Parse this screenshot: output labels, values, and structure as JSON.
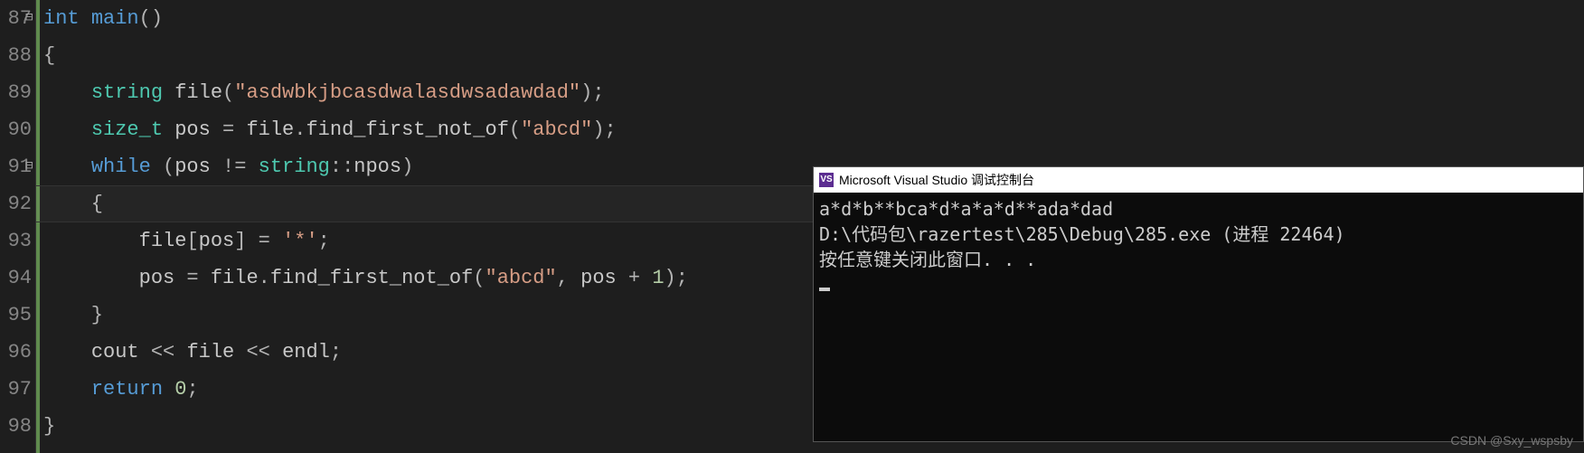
{
  "line_numbers": [
    "87",
    "88",
    "89",
    "90",
    "91",
    "92",
    "93",
    "94",
    "95",
    "96",
    "97",
    "98"
  ],
  "code_tokens": [
    [
      [
        "kw",
        "int"
      ],
      [
        "op",
        " "
      ],
      [
        "kw",
        "main"
      ],
      [
        "op",
        "()"
      ]
    ],
    [
      [
        "op",
        "{"
      ]
    ],
    [
      [
        "op",
        "    "
      ],
      [
        "type",
        "string"
      ],
      [
        "op",
        " "
      ],
      [
        "id",
        "file"
      ],
      [
        "op",
        "("
      ],
      [
        "str",
        "\"asdwbkjbcasdwalasdwsadawdad\""
      ],
      [
        "op",
        ");"
      ]
    ],
    [
      [
        "op",
        "    "
      ],
      [
        "type",
        "size_t"
      ],
      [
        "op",
        " "
      ],
      [
        "id",
        "pos"
      ],
      [
        "op",
        " = "
      ],
      [
        "id",
        "file"
      ],
      [
        "op",
        "."
      ],
      [
        "func",
        "find_first_not_of"
      ],
      [
        "op",
        "("
      ],
      [
        "str",
        "\"abcd\""
      ],
      [
        "op",
        ");"
      ]
    ],
    [
      [
        "op",
        "    "
      ],
      [
        "kw",
        "while"
      ],
      [
        "op",
        " ("
      ],
      [
        "id",
        "pos"
      ],
      [
        "op",
        " != "
      ],
      [
        "type",
        "string"
      ],
      [
        "op",
        "::"
      ],
      [
        "id",
        "npos"
      ],
      [
        "op",
        ")"
      ]
    ],
    [
      [
        "op",
        "    {"
      ]
    ],
    [
      [
        "op",
        "        "
      ],
      [
        "id",
        "file"
      ],
      [
        "op",
        "["
      ],
      [
        "id",
        "pos"
      ],
      [
        "op",
        "] = "
      ],
      [
        "str",
        "'*'"
      ],
      [
        "op",
        ";"
      ]
    ],
    [
      [
        "op",
        "        "
      ],
      [
        "id",
        "pos"
      ],
      [
        "op",
        " = "
      ],
      [
        "id",
        "file"
      ],
      [
        "op",
        "."
      ],
      [
        "func",
        "find_first_not_of"
      ],
      [
        "op",
        "("
      ],
      [
        "str",
        "\"abcd\""
      ],
      [
        "op",
        ", "
      ],
      [
        "id",
        "pos"
      ],
      [
        "op",
        " + "
      ],
      [
        "num",
        "1"
      ],
      [
        "op",
        ");"
      ]
    ],
    [
      [
        "op",
        "    }"
      ]
    ],
    [
      [
        "op",
        "    "
      ],
      [
        "id",
        "cout"
      ],
      [
        "op",
        " << "
      ],
      [
        "id",
        "file"
      ],
      [
        "op",
        " << "
      ],
      [
        "id",
        "endl"
      ],
      [
        "op",
        ";"
      ]
    ],
    [
      [
        "op",
        "    "
      ],
      [
        "kw",
        "return"
      ],
      [
        "op",
        " "
      ],
      [
        "num",
        "0"
      ],
      [
        "op",
        ";"
      ]
    ],
    [
      [
        "op",
        "}"
      ]
    ]
  ],
  "fold_markers": {
    "0": "-",
    "4": "-"
  },
  "console": {
    "icon_text": "VS",
    "title": "Microsoft Visual Studio 调试控制台",
    "lines": [
      "a*d*b**bca*d*a*a*d**ada*dad",
      "",
      "D:\\代码包\\razertest\\285\\Debug\\285.exe (进程 22464)",
      "按任意键关闭此窗口. . ."
    ]
  },
  "watermark": "CSDN @Sxy_wspsby"
}
